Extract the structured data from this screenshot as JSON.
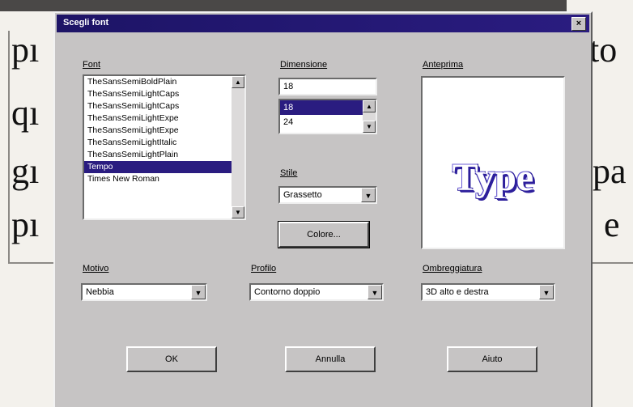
{
  "background_text": {
    "w1": "pı",
    "w2": "to",
    "w3": "qı",
    "w4": "gı",
    "w5": "pa",
    "w6": "pı",
    "w7": "e"
  },
  "dialog": {
    "title": "Scegli font",
    "close_glyph": "×",
    "font_label": "Font",
    "font_items": [
      "TheSansSemiBoldPlain",
      "TheSansSemiLightCaps",
      "TheSansSemiLightCaps",
      "TheSansSemiLightExpe",
      "TheSansSemiLightExpe",
      "TheSansSemiLightItalic",
      "TheSansSemiLightPlain",
      "Tempo",
      "Times New Roman"
    ],
    "size_label": "Dimensione",
    "size_value": "18",
    "size_items": [
      "18",
      "24"
    ],
    "style_label": "Stile",
    "style_value": "Grassetto",
    "color_button": "Colore...",
    "preview_label": "Anteprima",
    "preview_text": "Type",
    "shading_label": "Motivo",
    "shading_value": "Nebbia",
    "outline_label": "Profilo",
    "outline_value": "Contorno doppio",
    "shadow_label": "Ombreggiatura",
    "shadow_value": "3D alto e destra",
    "ok": "OK",
    "cancel": "Annulla",
    "help": "Aiuto"
  },
  "colors": {
    "titlebar": "#2a1c80",
    "dialog_face": "#c6c4c4",
    "selection": "#2a1c80",
    "preview_text": "#2d1f9c"
  },
  "icons": {
    "scroll_up": "up-arrow-icon",
    "scroll_down": "down-arrow-icon",
    "dropdown": "chevron-down-icon",
    "close": "close-icon"
  }
}
